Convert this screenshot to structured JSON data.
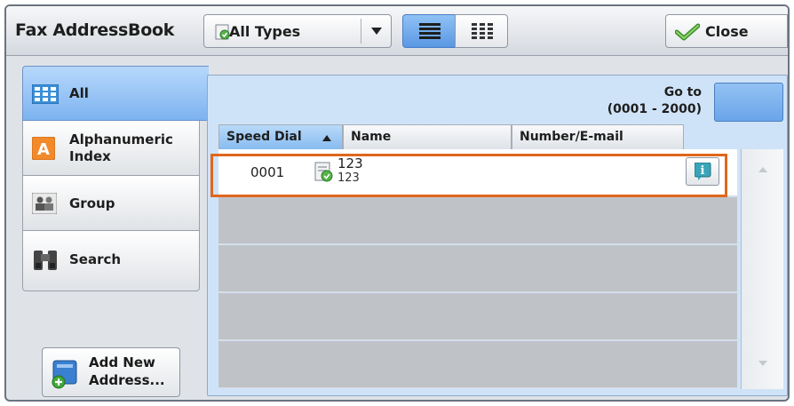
{
  "header": {
    "title": "Fax AddressBook",
    "type_selector": "All Types",
    "close_label": "Close"
  },
  "sidebar": {
    "items": [
      {
        "label": "All",
        "icon": "all-grid-icon",
        "active": true
      },
      {
        "label": "Alphanumeric Index",
        "line1": "Alphanumeric",
        "line2": "Index",
        "icon": "alphanumeric-a-icon"
      },
      {
        "label": "Group",
        "icon": "group-icon"
      },
      {
        "label": "Search",
        "icon": "binoculars-icon"
      }
    ],
    "add_line1": "Add New",
    "add_line2": "Address..."
  },
  "goto": {
    "label": "Go to",
    "range": "(0001 - 2000)"
  },
  "table": {
    "columns": [
      "Speed Dial",
      "Name",
      "Number/E-mail"
    ],
    "rows": [
      {
        "speed_dial": "0001",
        "name": "123",
        "number": "123"
      }
    ]
  },
  "colors": {
    "accent": "#7db3f0",
    "highlight": "#e0661d",
    "row_empty": "#bfc3c8"
  }
}
